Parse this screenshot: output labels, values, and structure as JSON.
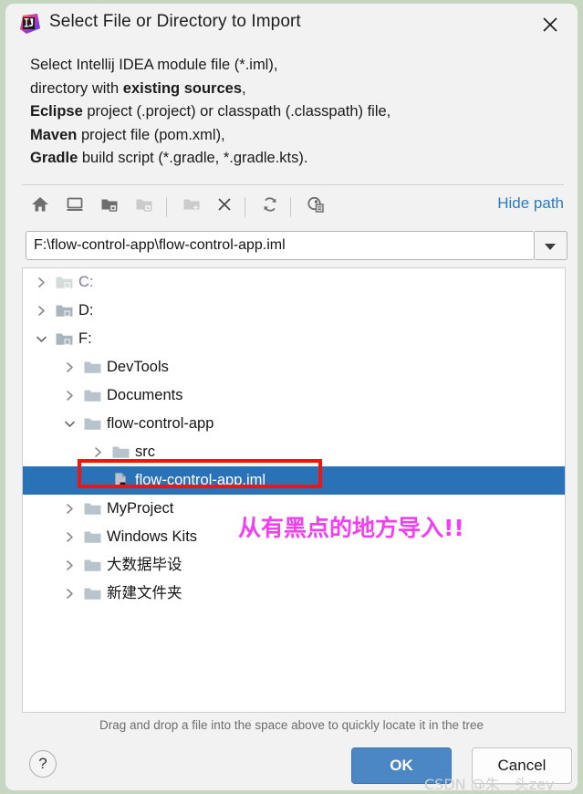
{
  "window": {
    "title": "Select File or Directory to Import",
    "app_icon": "intellij-idea-logo",
    "close_label": "✕"
  },
  "description": {
    "line1_pre": "Select Intellij IDEA module file (*.iml),",
    "line2_pre": "directory with ",
    "line2_bold": "existing sources",
    "line2_post": ",",
    "line3_bold": "Eclipse",
    "line3_post": " project (.project) or classpath (.classpath) file,",
    "line4_bold": "Maven",
    "line4_post": " project file (pom.xml),",
    "line5_bold": "Gradle",
    "line5_post": " build script (*.gradle, *.gradle.kts)."
  },
  "toolbar": {
    "buttons": [
      {
        "name": "home-icon",
        "tooltip": "Home"
      },
      {
        "name": "desktop-icon",
        "tooltip": "Desktop"
      },
      {
        "name": "project-folder-icon",
        "tooltip": "Project Directory"
      },
      {
        "name": "module-folder-icon",
        "tooltip": "Module Directory"
      },
      {
        "name": "new-folder-icon",
        "tooltip": "New Folder"
      },
      {
        "name": "delete-icon",
        "tooltip": "Delete"
      },
      {
        "name": "refresh-icon",
        "tooltip": "Refresh"
      },
      {
        "name": "show-hidden-icon",
        "tooltip": "Show Hidden Files"
      }
    ],
    "hide_path_label": "Hide path"
  },
  "path": {
    "value": "F:\\flow-control-app\\flow-control-app.iml",
    "placeholder": "",
    "dropdown_icon": "chevron-down-icon"
  },
  "tree": {
    "items": [
      {
        "label": "C:",
        "depth": 0,
        "state": "collapsed",
        "icon": "drive-folder-icon",
        "selected": false,
        "dim": true
      },
      {
        "label": "D:",
        "depth": 0,
        "state": "collapsed",
        "icon": "drive-folder-icon",
        "selected": false,
        "dim": false
      },
      {
        "label": "F:",
        "depth": 0,
        "state": "expanded",
        "icon": "drive-folder-icon",
        "selected": false,
        "dim": false
      },
      {
        "label": "DevTools",
        "depth": 1,
        "state": "collapsed",
        "icon": "folder-icon",
        "selected": false,
        "dim": false
      },
      {
        "label": "Documents",
        "depth": 1,
        "state": "collapsed",
        "icon": "folder-icon",
        "selected": false,
        "dim": false
      },
      {
        "label": "flow-control-app",
        "depth": 1,
        "state": "expanded",
        "icon": "folder-icon",
        "selected": false,
        "dim": false
      },
      {
        "label": "src",
        "depth": 2,
        "state": "collapsed",
        "icon": "folder-icon",
        "selected": false,
        "dim": false
      },
      {
        "label": "flow-control-app.iml",
        "depth": 2,
        "state": "leaf",
        "icon": "iml-file-icon",
        "selected": true,
        "dim": false
      },
      {
        "label": "MyProject",
        "depth": 1,
        "state": "collapsed",
        "icon": "folder-icon",
        "selected": false,
        "dim": false
      },
      {
        "label": "Windows Kits",
        "depth": 1,
        "state": "collapsed",
        "icon": "folder-icon",
        "selected": false,
        "dim": false
      },
      {
        "label": "大数据毕设",
        "depth": 1,
        "state": "collapsed",
        "icon": "folder-icon",
        "selected": false,
        "dim": false
      },
      {
        "label": "新建文件夹",
        "depth": 1,
        "state": "collapsed",
        "icon": "folder-icon",
        "selected": false,
        "dim": false
      }
    ]
  },
  "annotations": {
    "red_box": "highlight-selected-iml",
    "pink_note": "从有黑点的地方导入!!",
    "pink_color": "#f13ff1",
    "red_color": "#f4140f"
  },
  "hint": "Drag and drop a file into the space above to quickly locate it in the tree",
  "footer": {
    "help_label": "?",
    "ok_label": "OK",
    "cancel_label": "Cancel",
    "ok_color": "#4b87c4"
  },
  "watermark": "CSDN @朱一头zey"
}
